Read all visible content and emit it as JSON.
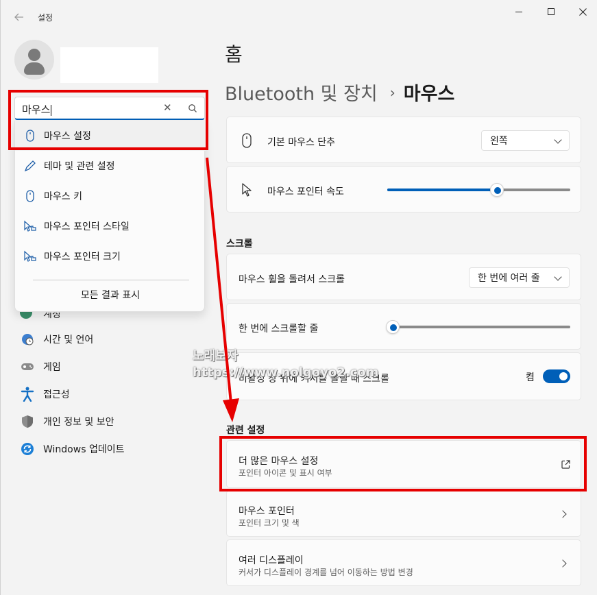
{
  "window": {
    "app_title": "설정"
  },
  "search": {
    "value": "마우스",
    "results": [
      {
        "label": "마우스 설정",
        "icon": "mouse-icon"
      },
      {
        "label": "테마 및 관련 설정",
        "icon": "pen-icon"
      },
      {
        "label": "마우스 키",
        "icon": "mouse-icon"
      },
      {
        "label": "마우스 포인터 스타일",
        "icon": "pointer-hand-icon"
      },
      {
        "label": "마우스 포인터 크기",
        "icon": "pointer-hand-icon"
      }
    ],
    "show_all": "모든 결과 표시"
  },
  "sidebar": {
    "items": [
      {
        "label": "계정",
        "icon": "account-icon"
      },
      {
        "label": "시간 및 언어",
        "icon": "globe-clock-icon"
      },
      {
        "label": "게임",
        "icon": "gamepad-icon"
      },
      {
        "label": "접근성",
        "icon": "accessibility-icon"
      },
      {
        "label": "개인 정보 및 보안",
        "icon": "shield-icon"
      },
      {
        "label": "Windows 업데이트",
        "icon": "update-icon"
      }
    ]
  },
  "main": {
    "home": "홈",
    "breadcrumb_parent": "Bluetooth 및 장치",
    "breadcrumb_sep": "›",
    "breadcrumb_current": "마우스",
    "primary_button": {
      "label": "기본 마우스 단추",
      "value": "왼쪽"
    },
    "pointer_speed": {
      "label": "마우스 포인터 속도",
      "level": 0.6
    },
    "scroll_section": "스크롤",
    "wheel_scroll": {
      "label": "마우스 휠을 돌려서 스크롤",
      "value": "한 번에 여러 줄"
    },
    "lines_per_scroll": {
      "label": "한 번에 스크롤할 줄",
      "level": 0.03
    },
    "inactive_scroll": {
      "label": "비활성 창 위에 커서를 올릴 때 스크롤",
      "state": "켬"
    },
    "related_section": "관련 설정",
    "related": [
      {
        "title": "더 많은 마우스 설정",
        "subtitle": "포인터 아이콘 및 표시 여부"
      },
      {
        "title": "마우스 포인터",
        "subtitle": "포인터 크기 및 색"
      },
      {
        "title": "여러 디스플레이",
        "subtitle": "커서가 디스플레이 경계를 넘어 이동하는 방법 변경"
      }
    ]
  },
  "watermark": {
    "line1": "노래보자",
    "line2": "https://www.nolgoyo2.com"
  },
  "colors": {
    "accent": "#005fb8",
    "annotation": "#e60000"
  }
}
